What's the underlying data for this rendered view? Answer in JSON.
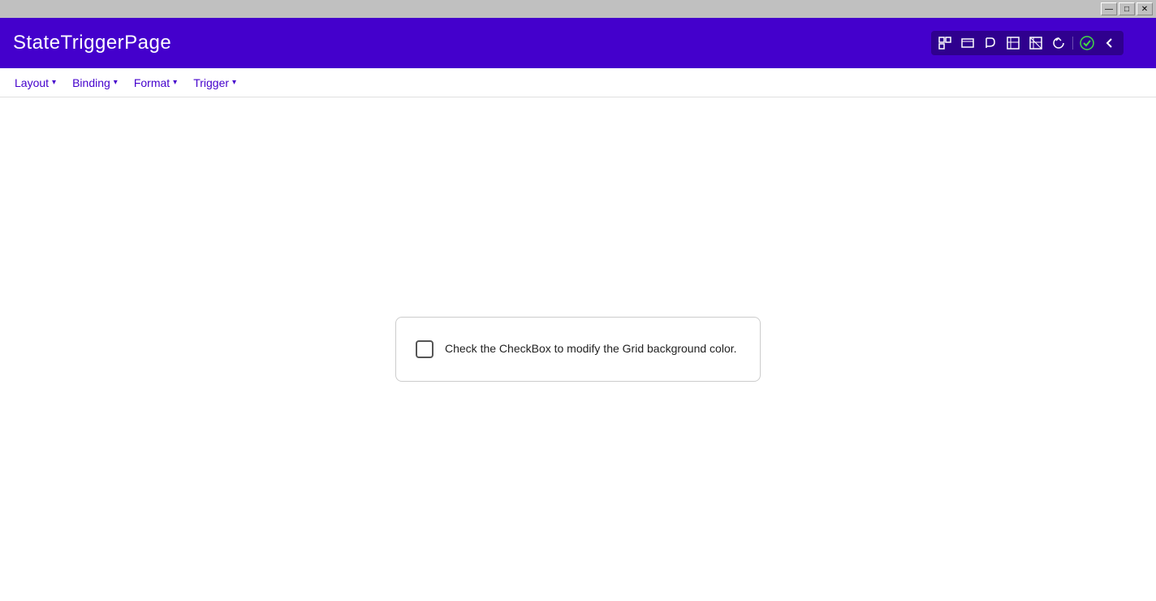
{
  "title_bar": {
    "minimize_label": "—",
    "restore_label": "□",
    "close_label": "✕"
  },
  "app_header": {
    "title": "StateTriggerPage",
    "toolbar": {
      "btn1": "⊞",
      "btn2": "▣",
      "btn3": "◫",
      "btn4": "⊟",
      "btn5": "⊠",
      "btn6": "↻",
      "btn7": "✔",
      "btn8": "‹"
    }
  },
  "menu_bar": {
    "items": [
      {
        "label": "Layout",
        "id": "layout"
      },
      {
        "label": "Binding",
        "id": "binding"
      },
      {
        "label": "Format",
        "id": "format"
      },
      {
        "label": "Trigger",
        "id": "trigger"
      }
    ]
  },
  "main": {
    "checkbox": {
      "label": "Check the CheckBox to modify the Grid background color.",
      "checked": false
    }
  }
}
